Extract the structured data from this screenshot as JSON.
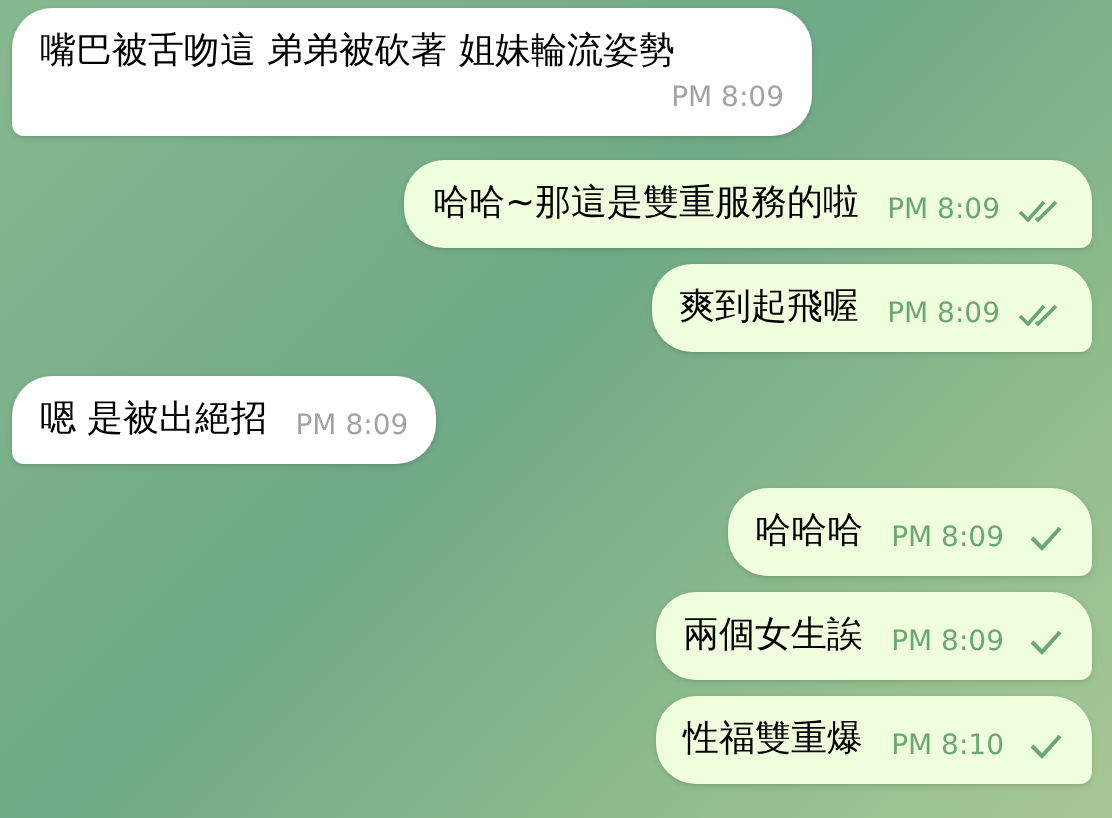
{
  "messages": [
    {
      "outgoing": false,
      "text": "嘴巴被舌吻這 弟弟被砍著  姐妹輪流姿勢",
      "time": "PM 8:09"
    },
    {
      "outgoing": true,
      "text": "哈哈~那這是雙重服務的啦",
      "time": "PM 8:09",
      "read": true
    },
    {
      "outgoing": true,
      "text": "爽到起飛喔",
      "time": "PM 8:09",
      "read": true
    },
    {
      "outgoing": false,
      "text": "嗯 是被出絕招",
      "time": "PM 8:09"
    },
    {
      "outgoing": true,
      "text": "哈哈哈",
      "time": "PM 8:09",
      "read": false
    },
    {
      "outgoing": true,
      "text": "兩個女生誒",
      "time": "PM 8:09",
      "read": false
    },
    {
      "outgoing": true,
      "text": "性福雙重爆",
      "time": "PM 8:10",
      "read": false
    }
  ]
}
